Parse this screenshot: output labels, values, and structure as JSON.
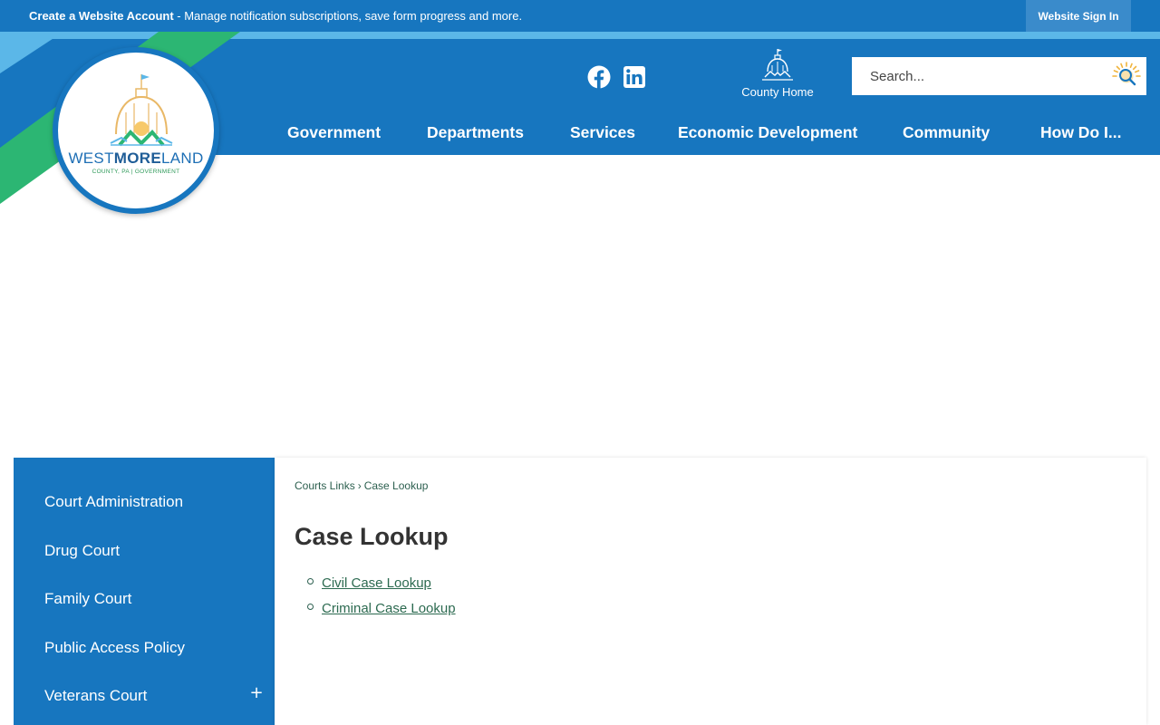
{
  "topbar": {
    "create_account": "Create a Website Account",
    "message": " - Manage notification subscriptions, save form progress and more.",
    "signin_label": "Website Sign In"
  },
  "logo": {
    "word_a": "WEST",
    "word_b": "MORE",
    "word_c": "LAND",
    "subtitle": "COUNTY, PA | GOVERNMENT"
  },
  "social": {
    "facebook": "facebook-icon",
    "linkedin": "linkedin-icon"
  },
  "county_home": {
    "label": "County Home"
  },
  "search": {
    "placeholder": "Search..."
  },
  "nav": {
    "items": [
      "Government",
      "Departments",
      "Services",
      "Economic Development",
      "Community",
      "How Do I..."
    ]
  },
  "sidebar": {
    "items": [
      "Court Administration",
      "Drug Court",
      "Family Court",
      "Public Access Policy",
      "Veterans Court"
    ],
    "expand_symbol": "+"
  },
  "breadcrumb": {
    "parent": "Courts Links",
    "separator": "›",
    "current": "Case Lookup"
  },
  "page": {
    "title": "Case Lookup",
    "links": [
      "Civil Case Lookup",
      "Criminal Case Lookup"
    ]
  },
  "colors": {
    "primary_blue": "#1776bf",
    "light_blue": "#5bb7e8",
    "green_accent": "#2cb673",
    "link_green": "#2c6a50"
  }
}
